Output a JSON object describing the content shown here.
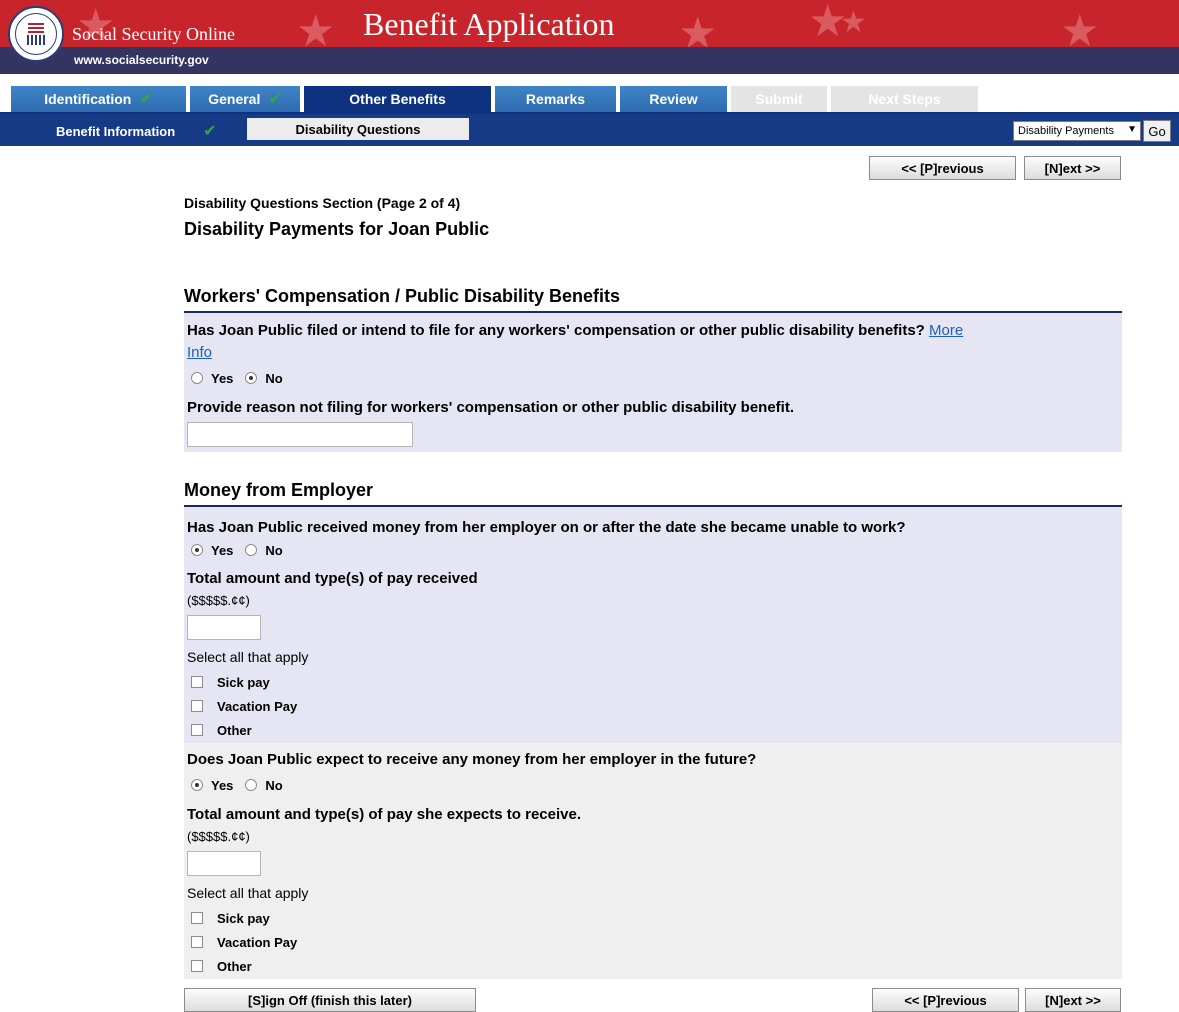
{
  "header": {
    "site_name": "Social Security Online",
    "site_url": "www.socialsecurity.gov",
    "app_title": "Benefit Application",
    "seal_text": "SOCIAL SECURITY ADMINISTRATION USA"
  },
  "tabs": [
    {
      "label": "Identification",
      "complete": true,
      "state": "normal"
    },
    {
      "label": "General",
      "complete": true,
      "state": "normal"
    },
    {
      "label": "Other Benefits",
      "complete": false,
      "state": "active"
    },
    {
      "label": "Remarks",
      "complete": false,
      "state": "normal"
    },
    {
      "label": "Review",
      "complete": false,
      "state": "normal"
    },
    {
      "label": "Submit",
      "complete": false,
      "state": "disabled"
    },
    {
      "label": "Next Steps",
      "complete": false,
      "state": "disabled"
    }
  ],
  "subnav": {
    "benefit_info": "Benefit Information",
    "disability_questions": "Disability Questions",
    "select_value": "Disability Payments",
    "go_label": "Go"
  },
  "nav": {
    "previous": "<< [P]revious",
    "next": "[N]ext >>",
    "sign_off": "[S]ign Off (finish this later)"
  },
  "page": {
    "section_title": "Disability Questions Section (Page 2 of 4)",
    "title": "Disability Payments for Joan Public"
  },
  "workers_comp": {
    "heading": "Workers' Compensation / Public Disability Benefits",
    "question_line1": "Has Joan Public filed or intend to file for any workers' compensation or other public disability benefits?",
    "more": "More",
    "info": "Info",
    "yes": "Yes",
    "no": "No",
    "answer": "No",
    "reason_label": "Provide reason not filing for workers' compensation or other public disability benefit.",
    "reason_value": ""
  },
  "employer": {
    "heading": "Money from Employer",
    "received": {
      "question": "Has Joan Public received money from her employer on or after the date she became unable to work?",
      "yes": "Yes",
      "no": "No",
      "answer": "Yes",
      "amount_label": "Total amount and type(s) of pay received",
      "format_hint": "($$$$$.¢¢)",
      "amount_value": "",
      "select_all": "Select all that apply",
      "options": [
        "Sick pay",
        "Vacation Pay",
        "Other"
      ]
    },
    "future": {
      "question": "Does Joan Public expect to receive any money from her employer in the future?",
      "yes": "Yes",
      "no": "No",
      "answer": "Yes",
      "amount_label": "Total amount and type(s) of pay she expects to receive.",
      "format_hint": "($$$$$.¢¢)",
      "amount_value": "",
      "select_all": "Select all that apply",
      "options": [
        "Sick pay",
        "Vacation Pay",
        "Other"
      ]
    }
  },
  "icons": {
    "check": "check-icon",
    "dropdown": "chevron-down-icon",
    "star": "star-icon"
  },
  "colors": {
    "header_red": "#c7242b",
    "header_navy": "#343462",
    "tab_blue": "#2f6bb0",
    "tab_active": "#0e3280",
    "panel_lavender": "#e5e5f3",
    "check_green": "#36a836",
    "link_blue": "#1a5fc7"
  }
}
